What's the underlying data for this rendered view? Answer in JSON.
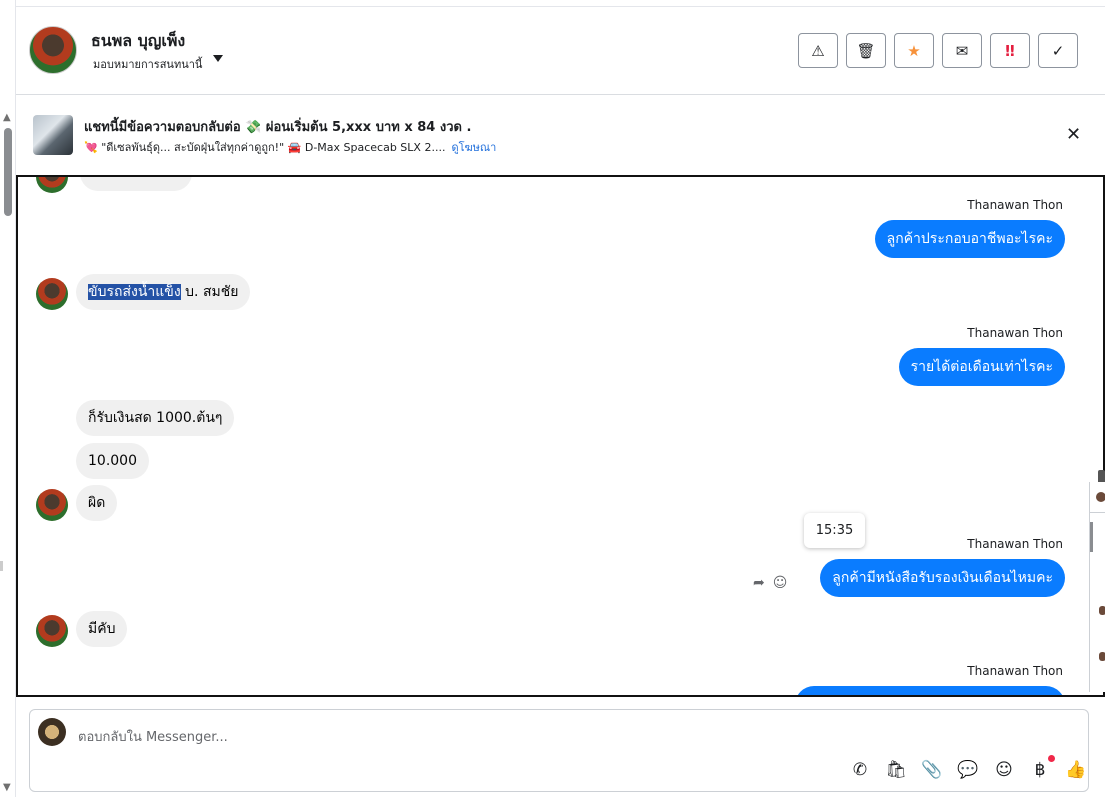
{
  "header": {
    "contact_name": "ธนพล บุญเพ็ง",
    "assign_label": "มอบหมายการสนทนานี้",
    "actions": {
      "spam": "⚠",
      "delete": "🗑",
      "star": "★",
      "mark_unread": "✉",
      "important": "‼",
      "done": "✓"
    }
  },
  "ad": {
    "title": "แชทนี้มีข้อความตอบกลับต่อ 💸 ผ่อนเริ่มต้น 5,xxx บาท x 84 งวด .",
    "subtitle": "💘 \"ดีเซลพันธุ์ดุ... สะบัดฝุ่นใส่ทุกค่าดูถูก!\" 🚘 D-Max Spacecab SLX 2....",
    "link": "ดูโฆษณา",
    "close": "✕"
  },
  "thread": {
    "messages": [
      {
        "sender": "Thanawan Thon",
        "text": "ลูกค้าประกอบอาชีพอะไรคะ"
      },
      {
        "highlight": "ขับรถส่งน้ำแข็ง",
        "rest": " บ. สมชัย"
      },
      {
        "sender": "Thanawan Thon",
        "text": "รายได้ต่อเดือนเท่าไรคะ"
      },
      {
        "text": "ก็รับเงินสด  1000.ต้นๆ"
      },
      {
        "text": "10.000"
      },
      {
        "text": "ผิด"
      },
      {
        "sender": "Thanawan Thon",
        "text": "ลูกค้ามีหนังสือรับรองเงินเดือนไหมคะ",
        "time": "15:35"
      },
      {
        "text": "มีคับ"
      },
      {
        "sender": "Thanawan Thon",
        "text": ""
      }
    ],
    "msg_actions": {
      "reply": "➦",
      "react": "☺"
    }
  },
  "composer": {
    "placeholder": "ตอบกลับใน Messenger...",
    "tools": {
      "call": "✆",
      "shop": "🛍",
      "attach": "📎",
      "chat": "💬",
      "emoji": "☺",
      "pay": "฿",
      "like": "👍"
    }
  },
  "colors": {
    "outgoing_bubble": "#0a7cff",
    "incoming_bubble": "#f0f0f0",
    "highlight": "#2452a6",
    "star": "#f7923b",
    "alert": "#e41e3f"
  }
}
